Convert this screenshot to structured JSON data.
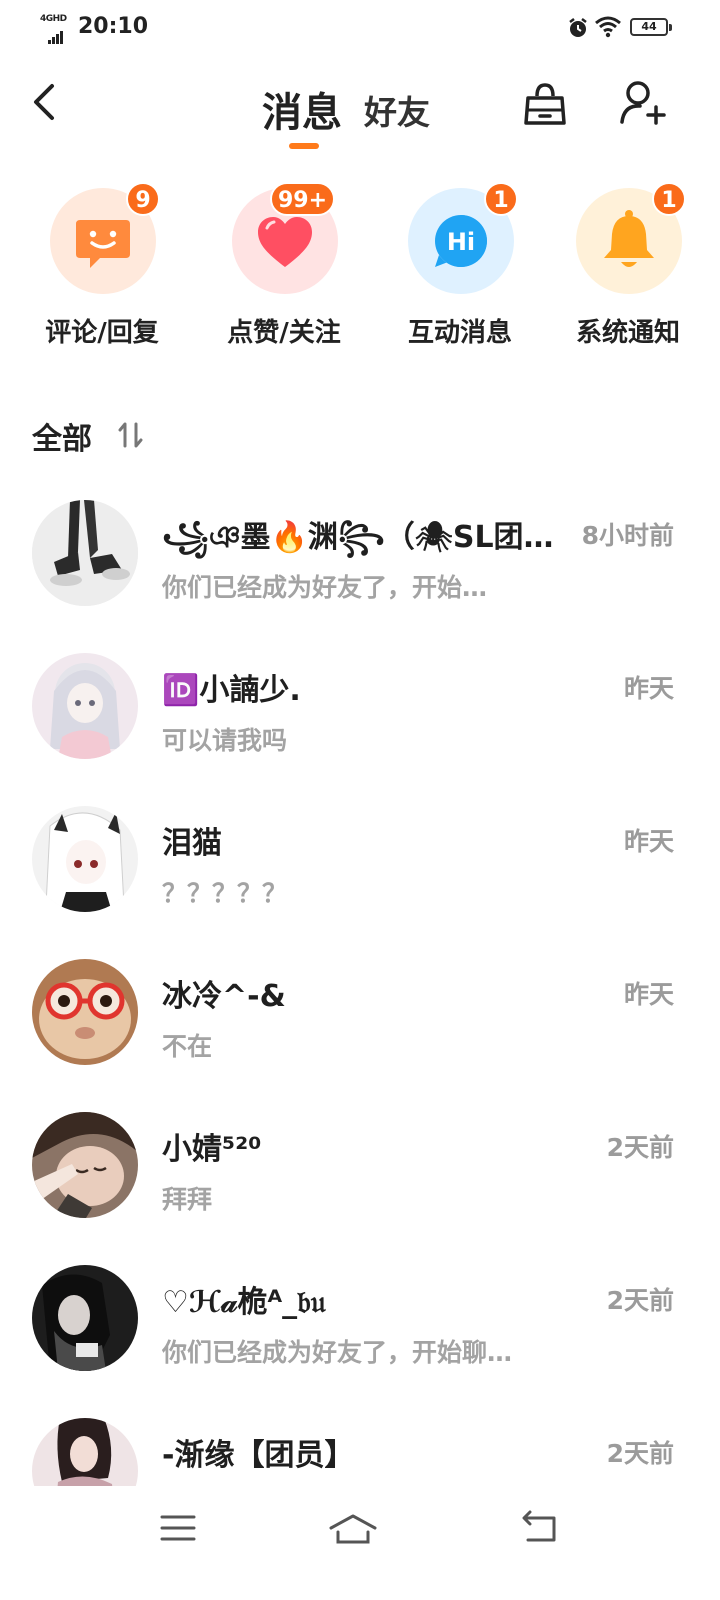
{
  "status_bar": {
    "network": "4GHD",
    "time": "20:10",
    "battery": "44"
  },
  "header": {
    "title_active": "消息",
    "title_inactive": "好友"
  },
  "categories": [
    {
      "label": "评论/回复",
      "badge": "9",
      "icon": "smile-chat-icon",
      "bg": "#ffe9dc",
      "color": "#ff8a3d"
    },
    {
      "label": "点赞/关注",
      "badge": "99+",
      "icon": "heart-icon",
      "bg": "#ffe3e3",
      "color": "#ff4f62"
    },
    {
      "label": "互动消息",
      "badge": "1",
      "icon": "hi-chat-icon",
      "bg": "#dff1ff",
      "color": "#20a4f3"
    },
    {
      "label": "系统通知",
      "badge": "1",
      "icon": "bell-icon",
      "bg": "#fff1d9",
      "color": "#ffa51f"
    }
  ],
  "section": {
    "title": "全部"
  },
  "messages": [
    {
      "name": "꧁ঞ墨🔥渊꧂（🕷SL团…",
      "time": "8小时前",
      "text": "你们已经成为好友了，开始…"
    },
    {
      "name": "🆔小諵少.",
      "time": "昨天",
      "text": "可以请我吗"
    },
    {
      "name": "泪猫",
      "time": "昨天",
      "text": "？？？？？"
    },
    {
      "name": "冰冷^-&",
      "time": "昨天",
      "text": "不在"
    },
    {
      "name": "小婧⁵²⁰",
      "time": "2天前",
      "text": "拜拜"
    },
    {
      "name": "♡ℋ𝒶桅ᴬ_𝔟𝔲",
      "time": "2天前",
      "text": "你们已经成为好友了，开始聊…"
    },
    {
      "name": "-渐缘【团员】",
      "time": "2天前",
      "text": ""
    }
  ],
  "colors": {
    "accent": "#ff7a1a",
    "badge": "#fa6b1a"
  }
}
